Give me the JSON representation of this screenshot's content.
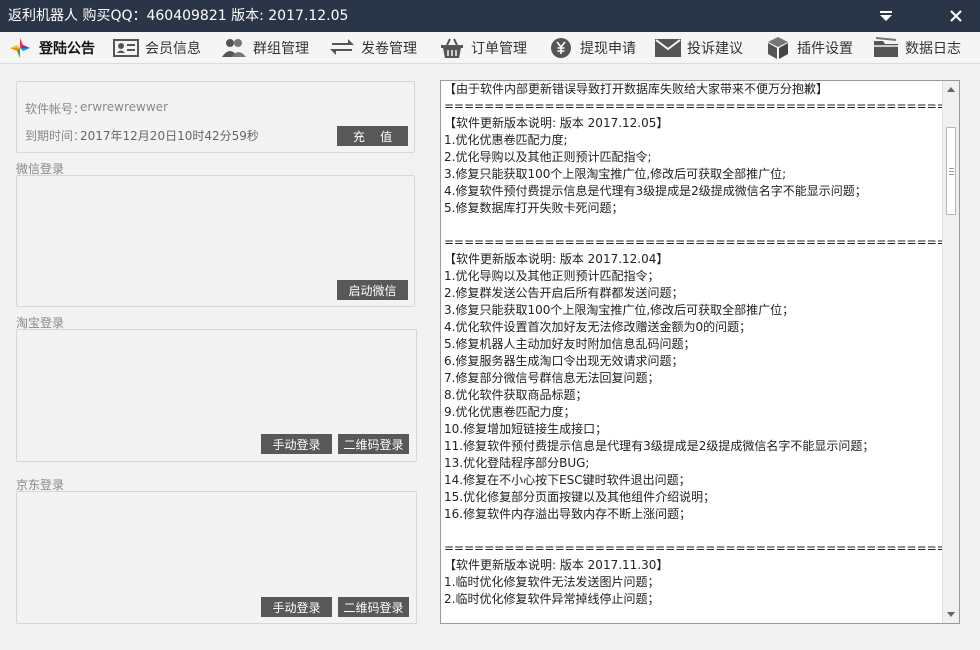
{
  "window": {
    "title": "返利机器人  购买QQ：460409821  版本: 2017.12.05"
  },
  "toolbar": {
    "items": [
      {
        "label": "登陆公告",
        "icon": "announcement-icon"
      },
      {
        "label": "会员信息",
        "icon": "member-card-icon"
      },
      {
        "label": "群组管理",
        "icon": "group-users-icon"
      },
      {
        "label": "发卷管理",
        "icon": "transfer-arrows-icon"
      },
      {
        "label": "订单管理",
        "icon": "basket-icon"
      },
      {
        "label": "提现申请",
        "icon": "yen-coin-icon"
      },
      {
        "label": "投诉建议",
        "icon": "mail-icon"
      },
      {
        "label": "插件设置",
        "icon": "cube-icon"
      },
      {
        "label": "数据日志",
        "icon": "folder-icon"
      }
    ]
  },
  "account": {
    "label": "软件帐号：",
    "username": "erwrewrewwer",
    "expiry_label": "到期时间：",
    "expiry": "2017年12月20日10时42分59秒",
    "recharge_button": "充    值"
  },
  "wechat": {
    "section_label": "微信登录",
    "start_button": "启动微信"
  },
  "taobao": {
    "section_label": "淘宝登录",
    "manual_button": "手动登录",
    "qr_button": "二维码登录"
  },
  "jd": {
    "section_label": "京东登录",
    "manual_button": "手动登录",
    "qr_button": "二维码登录"
  },
  "notice": {
    "lines": [
      "【由于软件内部更新错误导致打开数据库失败给大家带来不便万分抱歉】",
      "====================================================",
      "【软件更新版本说明: 版本 2017.12.05】",
      "1.优化优惠卷匹配力度;",
      "2.优化导购以及其他正则预计匹配指令;",
      "3.修复只能获取100个上限淘宝推广位,修改后可获取全部推广位;",
      "4.修复软件预付费提示信息是代理有3级提成是2级提成微信名字不能显示问题；",
      "5.修复数据库打开失败卡死问题；",
      "",
      "====================================================",
      "【软件更新版本说明: 版本 2017.12.04】",
      "1.优化导购以及其他正则预计匹配指令；",
      "2.修复群发送公告开启后所有群都发送问题；",
      "3.修复只能获取100个上限淘宝推广位,修改后可获取全部推广位；",
      "4.优化软件设置首次加好友无法修改赠送金额为0的问题；",
      "5.修复机器人主动加好友时附加信息乱码问题；",
      "6.修复服务器生成淘口令出现无效请求问题；",
      "7.修复部分微信号群信息无法回复问题；",
      "8.优化软件获取商品标题；",
      "9.优化优惠卷匹配力度；",
      "10.修复增加短链接生成接口；",
      "11.修复软件预付费提示信息是代理有3级提成是2级提成微信名字不能显示问题；",
      "13.优化登陆程序部分BUG;",
      "14.修复在不小心按下ESC键时软件退出问题；",
      "15.优化修复部分页面按键以及其他组件介绍说明；",
      "16.修复软件内存溢出导致内存不断上涨问题；",
      "",
      "====================================================",
      "【软件更新版本说明: 版本 2017.11.30】",
      "1.临时优化修复软件无法发送图片问题；",
      "2.临时优化修复软件异常掉线停止问题；"
    ]
  }
}
